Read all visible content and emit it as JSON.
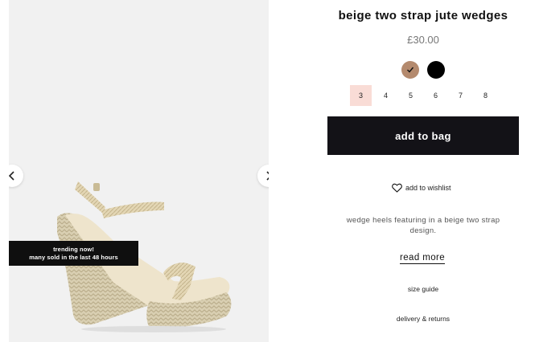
{
  "product": {
    "title": "beige two strap jute wedges",
    "price": "£30.00"
  },
  "gallery": {
    "prev_icon": "chevron-left-icon",
    "next_icon": "chevron-right-icon",
    "badge_line1": "trending now!",
    "badge_line2": "many sold in the last 48 hours"
  },
  "colors": [
    {
      "name": "beige",
      "hex": "#b48a6e",
      "selected": true,
      "icon": "check-icon"
    },
    {
      "name": "black",
      "hex": "#000000",
      "selected": false
    }
  ],
  "sizes": [
    {
      "label": "3",
      "selected": true
    },
    {
      "label": "4",
      "selected": false
    },
    {
      "label": "5",
      "selected": false
    },
    {
      "label": "6",
      "selected": false
    },
    {
      "label": "7",
      "selected": false
    },
    {
      "label": "8",
      "selected": false
    }
  ],
  "actions": {
    "add_to_bag": "add to bag",
    "wishlist": "add to wishlist",
    "wishlist_icon": "heart-icon"
  },
  "description": "wedge heels featuring in a beige two strap design.",
  "links": {
    "read_more": "read more",
    "size_guide": "size guide",
    "delivery_returns": "delivery & returns"
  },
  "theme": {
    "button_bg": "#131217",
    "selected_size_bg": "#f9dcd6",
    "gallery_bg": "#f1f1f1"
  }
}
